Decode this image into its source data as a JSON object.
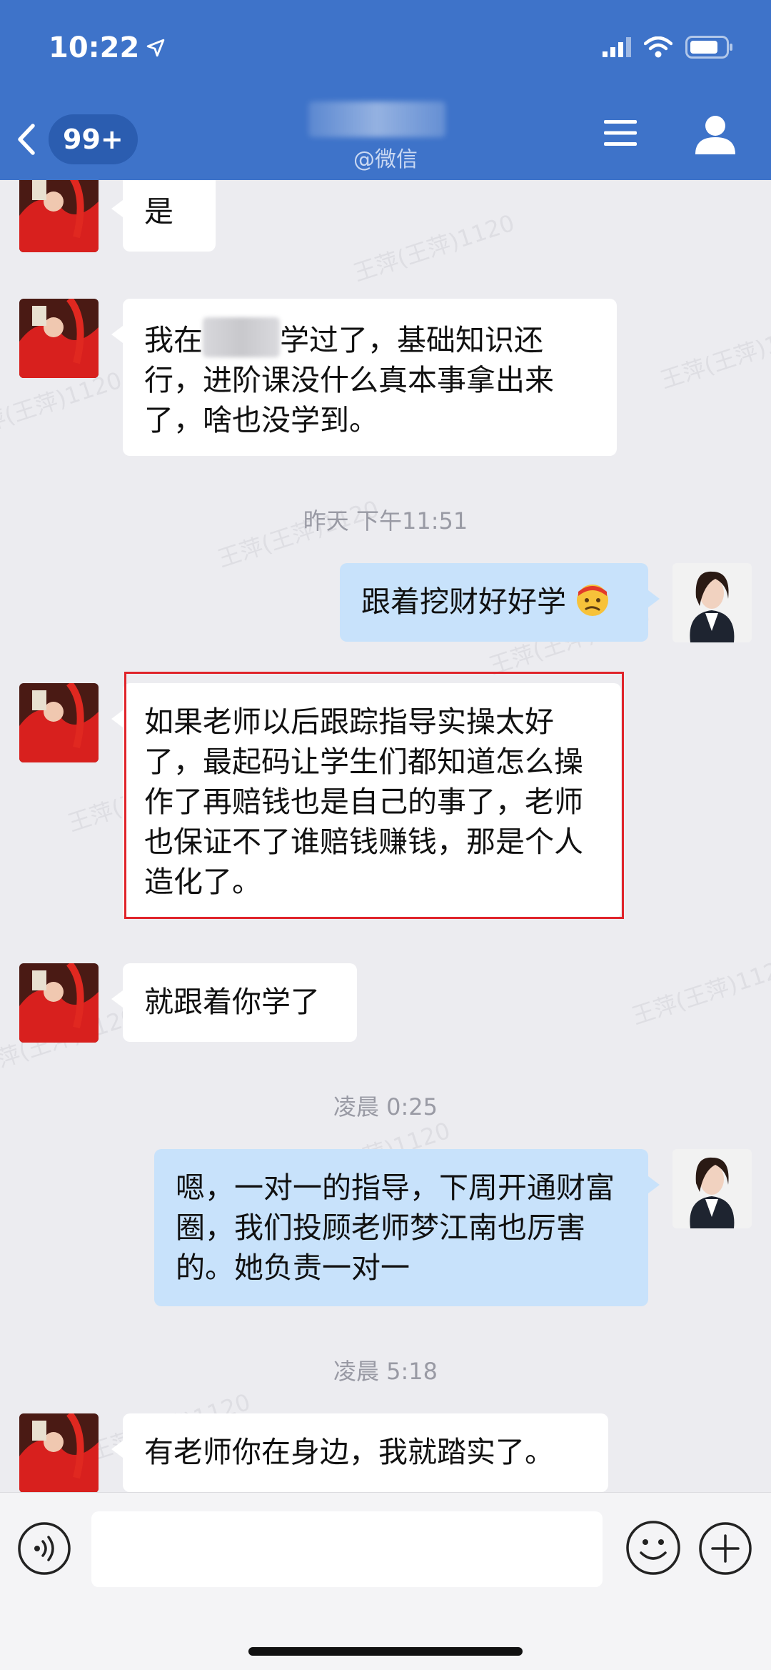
{
  "status_bar": {
    "time": "10:22"
  },
  "header": {
    "badge": "99+",
    "subtitle": "@微信"
  },
  "watermark": "王萍(王萍)1120",
  "messages": [
    {
      "side": "in",
      "text": "是"
    },
    {
      "side": "in",
      "text_before_blur": "我在",
      "text_after_blur": "学过了，基础知识还",
      "text_rest": "行，进阶课没什么真本事拿出来了，啥也没学到。"
    },
    {
      "side": "out",
      "text": "跟着挖财好好学",
      "emoji": "confused-face-emoji"
    },
    {
      "side": "in",
      "text": "如果老师以后跟踪指导实操太好了，最起码让学生们都知道怎么操作了再赔钱也是自己的事了，老师也保证不了谁赔钱赚钱，那是个人造化了。",
      "highlighted": true
    },
    {
      "side": "in",
      "text": "就跟着你学了"
    },
    {
      "side": "out",
      "text": "嗯，一对一的指导，下周开通财富圈，我们投顾老师梦江南也厉害的。她负责一对一"
    },
    {
      "side": "in",
      "text": "有老师你在身边，我就踏实了。"
    }
  ],
  "timestamps": [
    "昨天 下午11:51",
    "凌晨 0:25",
    "凌晨 5:18"
  ],
  "icons": {
    "back": "chevron-left-icon",
    "menu": "menu-icon",
    "profile": "person-icon",
    "voice": "voice-icon",
    "emoji": "smiley-icon",
    "plus": "plus-icon"
  },
  "colors": {
    "header": "#3e73c9",
    "out_bubble": "#c8e2fb",
    "highlight": "#e0242b"
  },
  "input": {
    "value": ""
  }
}
